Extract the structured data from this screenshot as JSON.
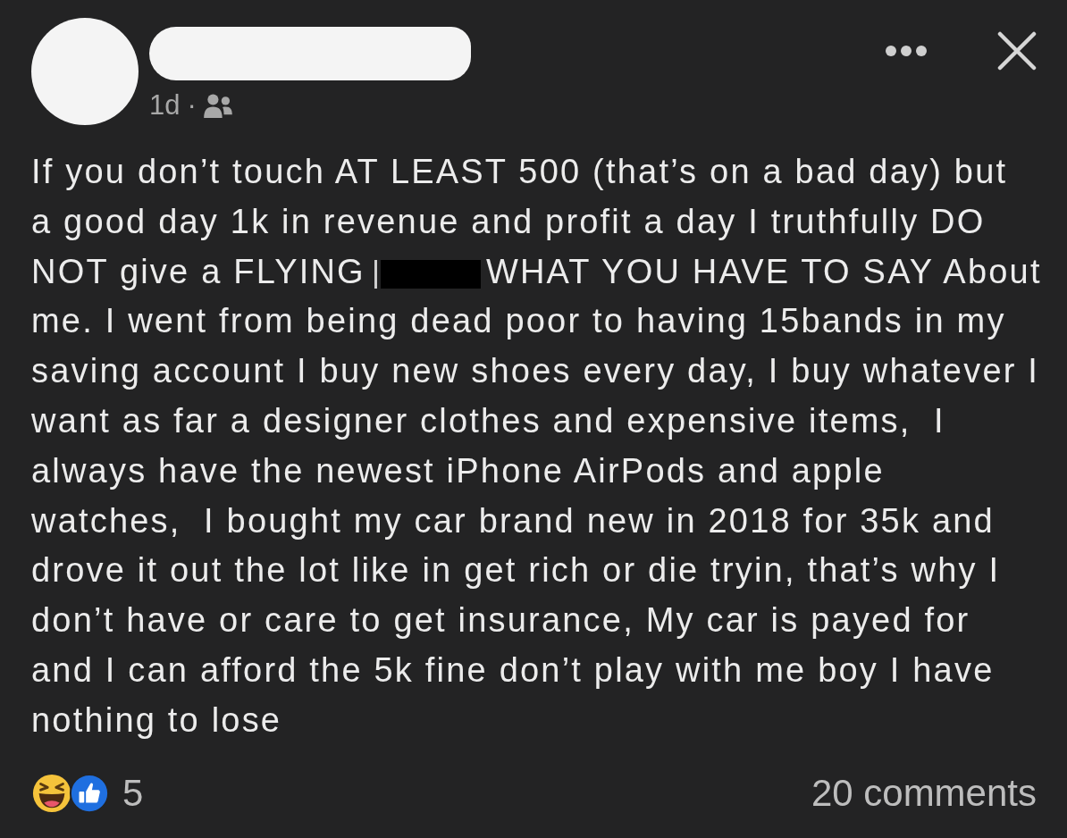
{
  "post": {
    "meta": {
      "time": "1d",
      "separator": "·"
    },
    "body": [
      {
        "kind": "text",
        "text": "If you don’t touch AT LEAST 500 (that’s on a bad day) but\na good day 1k in revenue and profit a day I truthfully DO"
      },
      {
        "kind": "line",
        "parts": [
          {
            "kind": "text",
            "text": "NOT give a FLYING"
          },
          {
            "kind": "redaction"
          },
          {
            "kind": "text",
            "text": "WHAT YOU HAVE TO SAY About"
          }
        ]
      },
      {
        "kind": "text",
        "text": "me. I went from being dead poor to having 15bands in my\nsaving account I buy new shoes every day, I buy whatever I\nwant as far a designer clothes and expensive items,  I\nalways have the newest iPhone AirPods and apple\nwatches,  I bought my car brand new in 2018 for 35k and\ndrove it out the lot like in get rich or die tryin, that’s why I\ndon’t have or care to get insurance, My car is payed for\nand I can afford the 5k fine don’t play with me boy I have\nnothing to lose"
      }
    ],
    "footer": {
      "reaction_count": "5",
      "comments": "20 comments"
    }
  }
}
